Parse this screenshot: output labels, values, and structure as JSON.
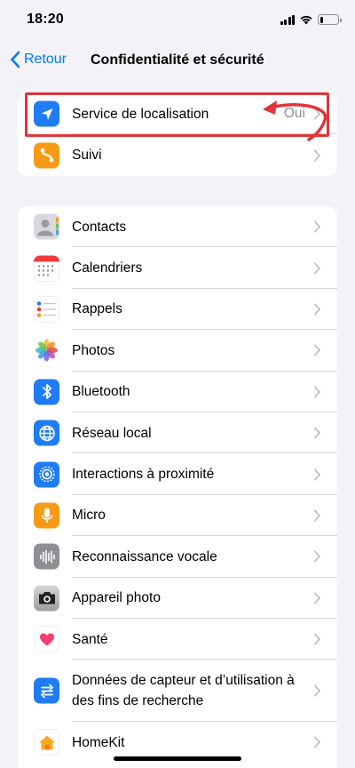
{
  "status_bar": {
    "time": "18:20",
    "battery_level": 0.2
  },
  "nav": {
    "back_label": "Retour",
    "title": "Confidentialité et sécurité"
  },
  "group1": [
    {
      "label": "Service de localisation",
      "value": "Oui",
      "icon": "location-arrow-icon",
      "color": "#1f7cf5"
    },
    {
      "label": "Suivi",
      "icon": "tracking-icon",
      "color": "#f79b16"
    }
  ],
  "group2": [
    {
      "label": "Contacts",
      "icon": "contacts-icon"
    },
    {
      "label": "Calendriers",
      "icon": "calendar-icon"
    },
    {
      "label": "Rappels",
      "icon": "reminders-icon"
    },
    {
      "label": "Photos",
      "icon": "photos-icon"
    },
    {
      "label": "Bluetooth",
      "icon": "bluetooth-icon",
      "color": "#1f7cf5"
    },
    {
      "label": "Réseau local",
      "icon": "globe-icon",
      "color": "#1f7cf5"
    },
    {
      "label": "Interactions à proximité",
      "icon": "nearby-icon",
      "color": "#1f7cf5"
    },
    {
      "label": "Micro",
      "icon": "microphone-icon",
      "color": "#f79b16"
    },
    {
      "label": "Reconnaissance vocale",
      "icon": "waveform-icon",
      "color": "#8e8e93"
    },
    {
      "label": "Appareil photo",
      "icon": "camera-icon",
      "color": "#8e8e93"
    },
    {
      "label": "Santé",
      "icon": "health-heart-icon"
    },
    {
      "label": "Données de capteur et d’utilisation à des fins de recherche",
      "icon": "research-icon",
      "color": "#1f7cf5"
    },
    {
      "label": "HomeKit",
      "icon": "home-icon"
    }
  ],
  "annotation": {
    "color": "#e0353b"
  }
}
